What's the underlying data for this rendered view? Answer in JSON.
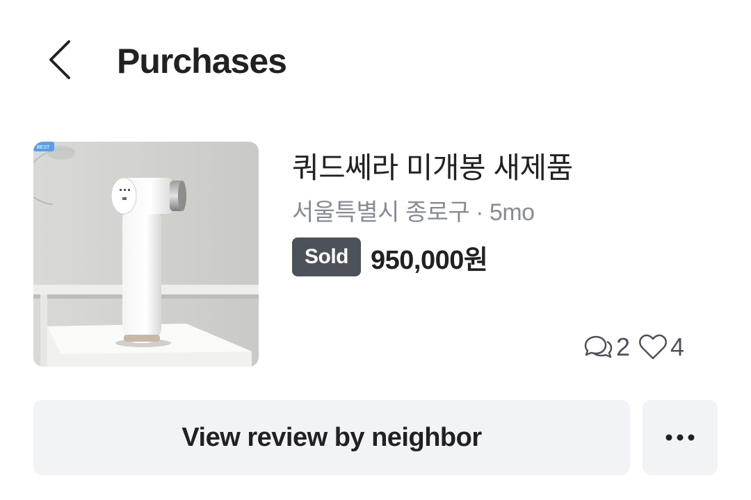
{
  "header": {
    "title": "Purchases"
  },
  "item": {
    "title": "쿼드쎄라 미개봉 새제품",
    "location": "서울특별시 종로구",
    "separator": " · ",
    "time_ago": "5mo",
    "status": "Sold",
    "price": "950,000원",
    "comment_count": "2",
    "like_count": "4",
    "thumbnail_badge": "BEST"
  },
  "actions": {
    "review_button_label": "View review by neighbor"
  },
  "icons": {
    "back": "chevron-left-icon",
    "comments": "chat-bubbles-icon",
    "likes": "heart-outline-icon",
    "more": "more-horizontal-icon"
  },
  "colors": {
    "text_primary": "#212124",
    "text_secondary": "#868b94",
    "badge_bg": "#4d5159",
    "button_bg": "#f2f3f6"
  }
}
